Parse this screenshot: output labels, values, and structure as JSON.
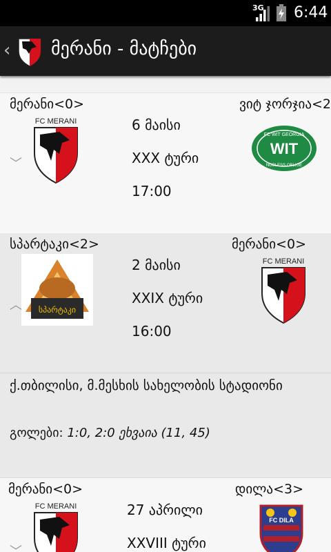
{
  "status_bar": {
    "network": "3G",
    "time": "6:44"
  },
  "action_bar": {
    "title": "მერანი - მატჩები"
  },
  "matches": [
    {
      "home": "მერანი<0>",
      "away": "ვიტ ჯორჯია<2",
      "date": "6 მაისი",
      "round": "XXX ტური",
      "time": "17:00",
      "home_logo_text": "FC MERANI",
      "away_logo_text": "FC WIT GEORGIA",
      "away_logo_motto": "NOBLESS OBLIGE"
    },
    {
      "home": "სპარტაკი<2>",
      "away": "მერანი<0>",
      "date": "2 მაისი",
      "round": "XXIX ტური",
      "time": "16:00",
      "home_logo_text": "სპარტაკი",
      "away_logo_text": "FC MERANI",
      "venue": "ქ.თბილისი, მ.მესხის სახელობის სტადიონი",
      "goals_label": "გოლები:",
      "goals_value": "1:0, 2:0 ეხვაია (11, 45)"
    },
    {
      "home": "მერანი<0>",
      "away": "დილა<3>",
      "date": "27 აპრილი",
      "round": "XXVIII ტური",
      "home_logo_text": "FC MERANI",
      "away_logo_text": "FC DILA"
    }
  ]
}
